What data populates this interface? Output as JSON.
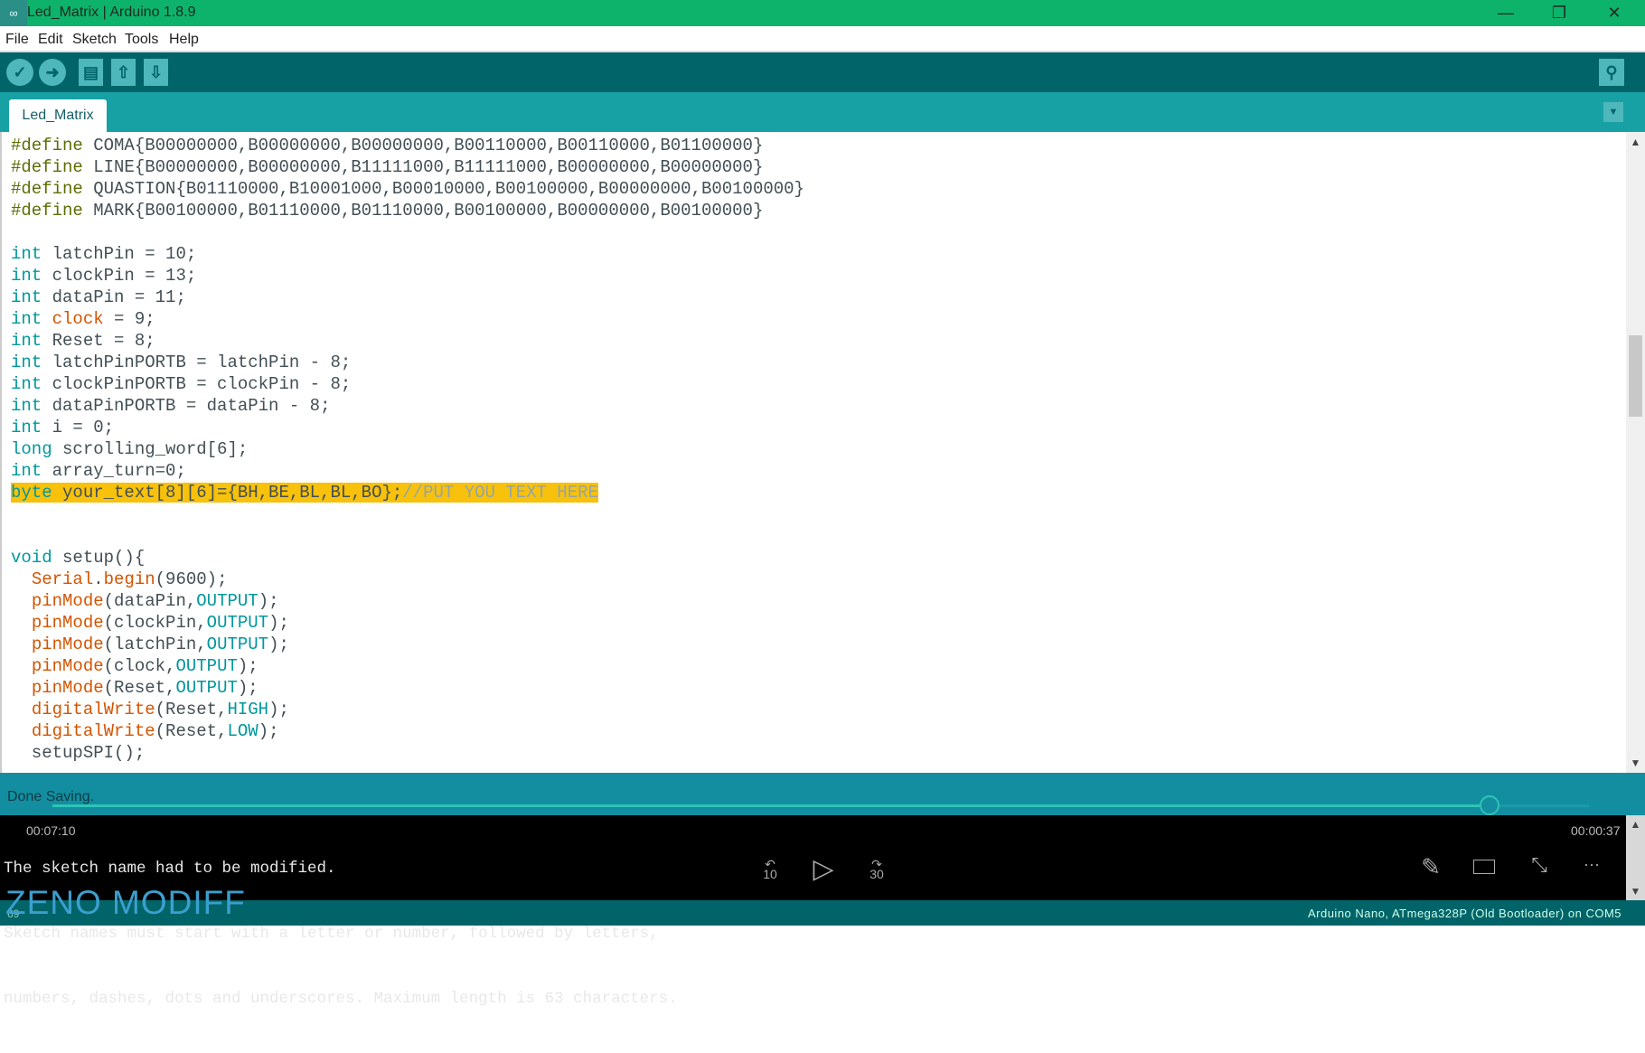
{
  "window": {
    "title": "Led_Matrix | Arduino 1.8.9",
    "logo_icon": "arduino-logo-icon",
    "minimize": "—",
    "restore": "❐",
    "close": "✕"
  },
  "menu": [
    "File",
    "Edit",
    "Sketch",
    "Tools",
    "Help"
  ],
  "toolbar": {
    "verify": "✓",
    "upload": "➜",
    "new": "▤",
    "open": "⇧",
    "save": "⇩",
    "serial_monitor": "⚲"
  },
  "tab": {
    "label": "Led_Matrix",
    "menu_icon": "▼"
  },
  "code": [
    [
      [
        "#define",
        "def"
      ],
      [
        " COMA{B00000000,B00000000,B00000000,B00110000,B00110000,B01100000}",
        "txt"
      ]
    ],
    [
      [
        "#define",
        "def"
      ],
      [
        " LINE{B00000000,B00000000,B11111000,B11111000,B00000000,B00000000}",
        "txt"
      ]
    ],
    [
      [
        "#define",
        "def"
      ],
      [
        " QUASTION{B01110000,B10001000,B00010000,B00100000,B00000000,B00100000}",
        "txt"
      ]
    ],
    [
      [
        "#define",
        "def"
      ],
      [
        " MARK{B00100000,B01110000,B01110000,B00100000,B00000000,B00100000}",
        "txt"
      ]
    ],
    [],
    [
      [
        "int",
        "kw"
      ],
      [
        " latchPin = 10;",
        "txt"
      ]
    ],
    [
      [
        "int",
        "kw"
      ],
      [
        " clockPin = 13;",
        "txt"
      ]
    ],
    [
      [
        "int",
        "kw"
      ],
      [
        " dataPin = 11;",
        "txt"
      ]
    ],
    [
      [
        "int",
        "kw"
      ],
      [
        " ",
        "txt"
      ],
      [
        "clock",
        "fn"
      ],
      [
        " = 9;",
        "txt"
      ]
    ],
    [
      [
        "int",
        "kw"
      ],
      [
        " Reset = 8;",
        "txt"
      ]
    ],
    [
      [
        "int",
        "kw"
      ],
      [
        " latchPinPORTB = latchPin - 8;",
        "txt"
      ]
    ],
    [
      [
        "int",
        "kw"
      ],
      [
        " clockPinPORTB = clockPin - 8;",
        "txt"
      ]
    ],
    [
      [
        "int",
        "kw"
      ],
      [
        " dataPinPORTB = dataPin - 8;",
        "txt"
      ]
    ],
    [
      [
        "int",
        "kw"
      ],
      [
        " i = 0;",
        "txt"
      ]
    ],
    [
      [
        "long",
        "kw"
      ],
      [
        " scrolling_word[6];",
        "txt"
      ]
    ],
    [
      [
        "int",
        "kw"
      ],
      [
        " array_turn=0;",
        "txt"
      ]
    ],
    [
      [
        "byte",
        "kw"
      ],
      [
        " your_text[8][6]={BH,BE,BL,BL,BO};",
        "txt"
      ],
      [
        "//PUT YOU TEXT HERE",
        "cm"
      ]
    ],
    [],
    [],
    [
      [
        "void",
        "kw"
      ],
      [
        " setup(){",
        "txt"
      ]
    ],
    [
      [
        "  ",
        "txt"
      ],
      [
        "Serial",
        "fn"
      ],
      [
        ".",
        "txt"
      ],
      [
        "begin",
        "fn"
      ],
      [
        "(9600);",
        "txt"
      ]
    ],
    [
      [
        "  ",
        "txt"
      ],
      [
        "pinMode",
        "fn"
      ],
      [
        "(dataPin,",
        "txt"
      ],
      [
        "OUTPUT",
        "cst"
      ],
      [
        ");",
        "txt"
      ]
    ],
    [
      [
        "  ",
        "txt"
      ],
      [
        "pinMode",
        "fn"
      ],
      [
        "(clockPin,",
        "txt"
      ],
      [
        "OUTPUT",
        "cst"
      ],
      [
        ");",
        "txt"
      ]
    ],
    [
      [
        "  ",
        "txt"
      ],
      [
        "pinMode",
        "fn"
      ],
      [
        "(latchPin,",
        "txt"
      ],
      [
        "OUTPUT",
        "cst"
      ],
      [
        ");",
        "txt"
      ]
    ],
    [
      [
        "  ",
        "txt"
      ],
      [
        "pinMode",
        "fn"
      ],
      [
        "(clock,",
        "txt"
      ],
      [
        "OUTPUT",
        "cst"
      ],
      [
        ");",
        "txt"
      ]
    ],
    [
      [
        "  ",
        "txt"
      ],
      [
        "pinMode",
        "fn"
      ],
      [
        "(Reset,",
        "txt"
      ],
      [
        "OUTPUT",
        "cst"
      ],
      [
        ");",
        "txt"
      ]
    ],
    [
      [
        "  ",
        "txt"
      ],
      [
        "digitalWrite",
        "fn"
      ],
      [
        "(Reset,",
        "txt"
      ],
      [
        "HIGH",
        "cst"
      ],
      [
        ");",
        "txt"
      ]
    ],
    [
      [
        "  ",
        "txt"
      ],
      [
        "digitalWrite",
        "fn"
      ],
      [
        "(Reset,",
        "txt"
      ],
      [
        "LOW",
        "cst"
      ],
      [
        ");",
        "txt"
      ]
    ],
    [
      [
        "  setupSPI();",
        "txt"
      ]
    ]
  ],
  "highlighted_line": 16,
  "status": {
    "message": "Done Saving."
  },
  "console": [
    "The sketch name had to be modified.",
    "Sketch names must start with a letter or number, followed by letters,",
    "numbers, dashes, dots and underscores. Maximum length is 63 characters."
  ],
  "bottom": {
    "line_number": "69",
    "board": "Arduino Nano, ATmega328P (Old Bootloader) on COM5"
  },
  "video_overlay": {
    "elapsed": "00:07:10",
    "remaining": "00:00:37",
    "progress": 0.935,
    "skip_back": "10",
    "skip_forward": "30",
    "play": "▷",
    "pencil": "✎",
    "more": "···"
  },
  "watermark": "ZENO MODIFF"
}
